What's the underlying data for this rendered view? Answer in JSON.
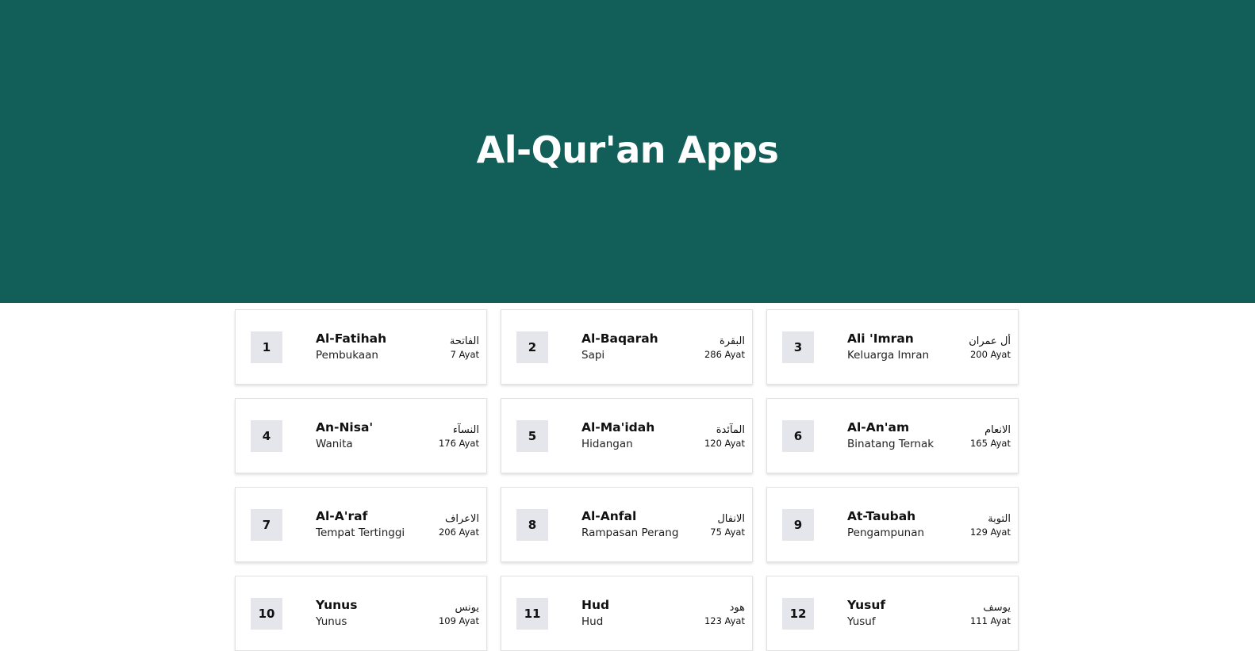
{
  "app": {
    "title": "Al-Qur'an Apps",
    "header_color": "#125f5a"
  },
  "surahs": [
    {
      "number": "1",
      "latin": "Al-Fatihah",
      "meaning": "Pembukaan",
      "arabic": "الفاتحة",
      "ayat": "7 Ayat"
    },
    {
      "number": "2",
      "latin": "Al-Baqarah",
      "meaning": "Sapi",
      "arabic": "البقرة",
      "ayat": "286 Ayat"
    },
    {
      "number": "3",
      "latin": "Ali 'Imran",
      "meaning": "Keluarga Imran",
      "arabic": "أل عمران",
      "ayat": "200 Ayat"
    },
    {
      "number": "4",
      "latin": "An-Nisa'",
      "meaning": "Wanita",
      "arabic": "النسآء",
      "ayat": "176 Ayat"
    },
    {
      "number": "5",
      "latin": "Al-Ma'idah",
      "meaning": "Hidangan",
      "arabic": "المآئدة",
      "ayat": "120 Ayat"
    },
    {
      "number": "6",
      "latin": "Al-An'am",
      "meaning": "Binatang Ternak",
      "arabic": "الانعام",
      "ayat": "165 Ayat"
    },
    {
      "number": "7",
      "latin": "Al-A'raf",
      "meaning": "Tempat Tertinggi",
      "arabic": "الاعراف",
      "ayat": "206 Ayat"
    },
    {
      "number": "8",
      "latin": "Al-Anfal",
      "meaning": "Rampasan Perang",
      "arabic": "الانفال",
      "ayat": "75 Ayat"
    },
    {
      "number": "9",
      "latin": "At-Taubah",
      "meaning": "Pengampunan",
      "arabic": "التوبة",
      "ayat": "129 Ayat"
    },
    {
      "number": "10",
      "latin": "Yunus",
      "meaning": "Yunus",
      "arabic": "يونس",
      "ayat": "109 Ayat"
    },
    {
      "number": "11",
      "latin": "Hud",
      "meaning": "Hud",
      "arabic": "هود",
      "ayat": "123 Ayat"
    },
    {
      "number": "12",
      "latin": "Yusuf",
      "meaning": "Yusuf",
      "arabic": "يوسف",
      "ayat": "111 Ayat"
    }
  ]
}
